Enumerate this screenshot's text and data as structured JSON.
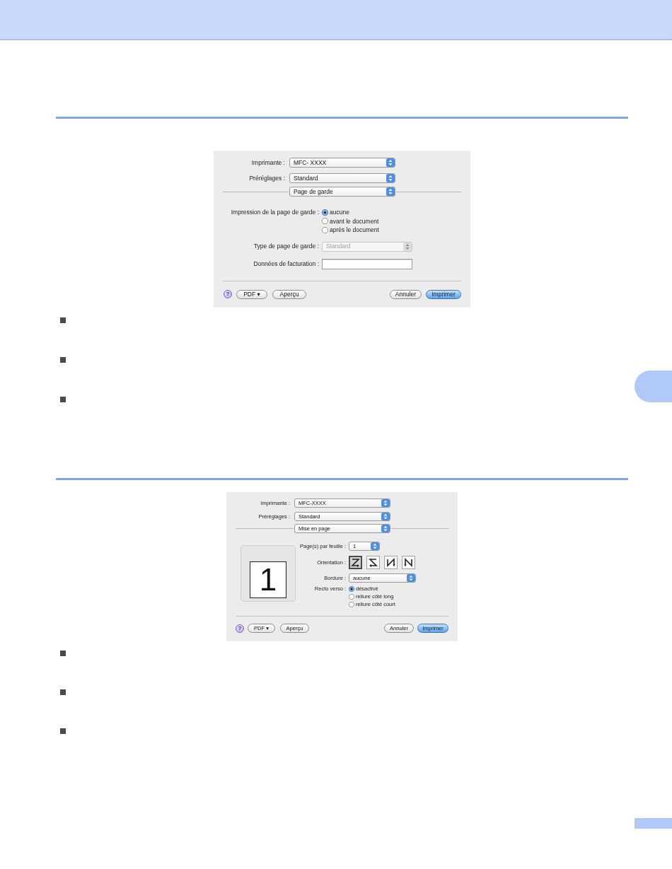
{
  "sections": [
    {
      "dialog": {
        "printer": {
          "label": "Imprimante :",
          "value": "MFC- XXXX"
        },
        "presets": {
          "label": "Préréglages :",
          "value": "Standard"
        },
        "panel": {
          "value": "Page de garde"
        },
        "options": [
          {
            "kind": "radio",
            "label": "Impression de la page de garde :",
            "choices": [
              {
                "label": "aucune",
                "selected": true
              },
              {
                "label": "avant le document",
                "selected": false
              },
              {
                "label": "après le document",
                "selected": false
              }
            ]
          },
          {
            "kind": "popup",
            "label": "Type de page de garde :",
            "value": "Standard",
            "disabled": true
          },
          {
            "kind": "text",
            "label": "Données de facturation :"
          }
        ],
        "footer": {
          "help": "?",
          "buttons": [
            {
              "kind": "pdf",
              "label": "PDF ▾",
              "default": false
            },
            {
              "kind": "preview",
              "label": "Aperçu",
              "default": false
            },
            {
              "kind": "cancel",
              "label": "Annuler",
              "default": false
            },
            {
              "kind": "print",
              "label": "Imprimer",
              "default": true
            }
          ]
        }
      }
    },
    {
      "dialog": {
        "printer": {
          "label": "Imprimante :",
          "value": "MFC-XXXX"
        },
        "presets": {
          "label": "Préréglages :",
          "value": "Standard"
        },
        "panel": {
          "value": "Mise en page"
        },
        "preview": {
          "page": "1"
        },
        "options": [
          {
            "kind": "popup",
            "label": "Page(s) par feuille :",
            "value": "1",
            "disabled": false
          },
          {
            "kind": "orientation",
            "label": "Orientation :",
            "choices": [
              {
                "selected": true
              },
              {
                "selected": false
              },
              {
                "selected": false
              },
              {
                "selected": false
              }
            ]
          },
          {
            "kind": "popup",
            "label": "Bordure :",
            "value": "aucune",
            "disabled": false
          },
          {
            "kind": "radio",
            "label": "Recto verso :",
            "choices": [
              {
                "label": "désactivé",
                "selected": true
              },
              {
                "label": "reliure côté long",
                "selected": false
              },
              {
                "label": "reliure côté court",
                "selected": false
              }
            ]
          }
        ],
        "footer": {
          "help": "?",
          "buttons": [
            {
              "kind": "pdf",
              "label": "PDF ▾",
              "default": false
            },
            {
              "kind": "preview",
              "label": "Aperçu",
              "default": false
            },
            {
              "kind": "cancel",
              "label": "Annuler",
              "default": false
            },
            {
              "kind": "print",
              "label": "Imprimer",
              "default": true
            }
          ]
        }
      }
    }
  ]
}
